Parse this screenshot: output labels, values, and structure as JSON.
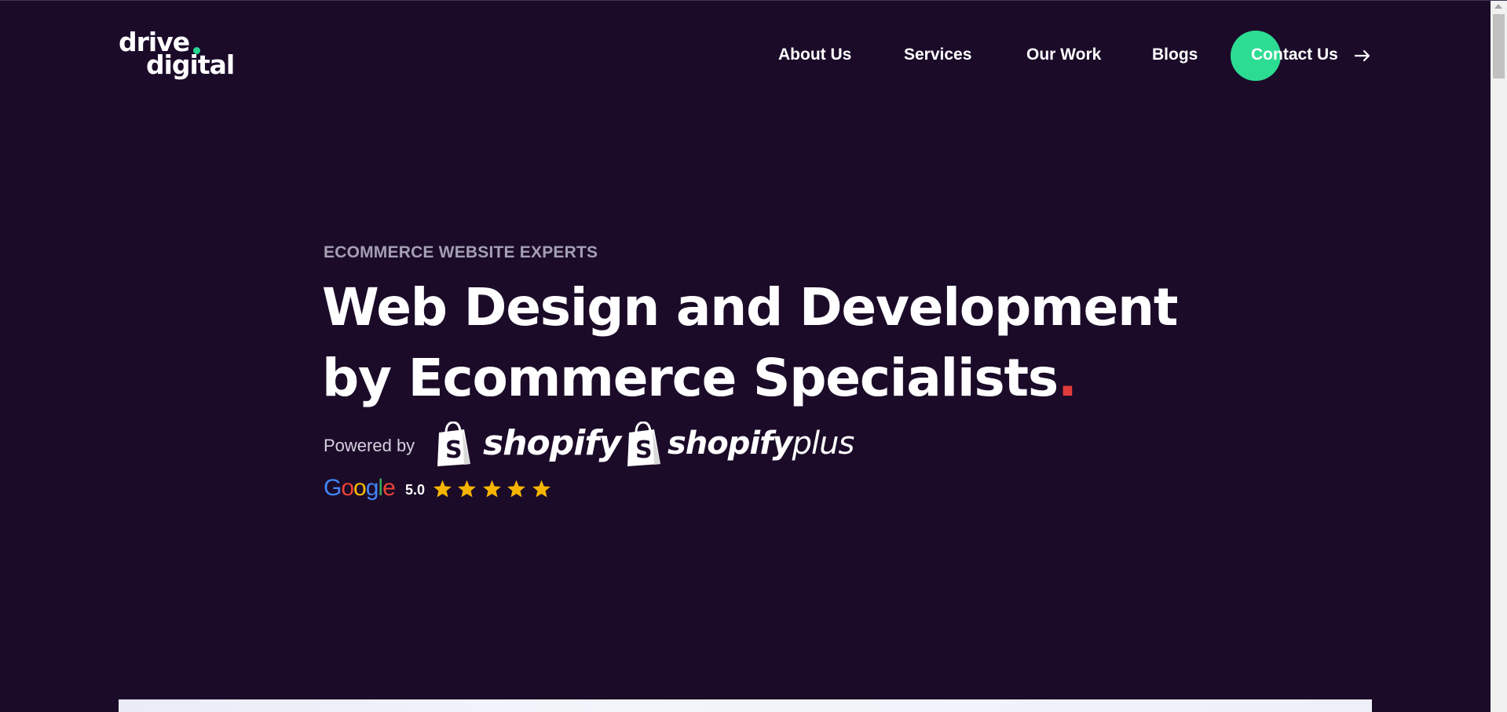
{
  "header": {
    "logo": {
      "line1": "drive",
      "line2": "digital",
      "dot_color": "#27d592"
    },
    "nav": [
      {
        "label": "About Us"
      },
      {
        "label": "Services"
      },
      {
        "label": "Our Work"
      },
      {
        "label": "Blogs"
      }
    ],
    "contact": {
      "label": "Contact Us",
      "icon": "arrow-right-icon",
      "bubble_color": "#2ddc93"
    }
  },
  "hero": {
    "eyebrow": "ECOMMERCE WEBSITE EXPERTS",
    "headline_line1": "Web Design and Development",
    "headline_line2": "by Ecommerce Specialists",
    "headline_dot": ".",
    "accent_color": "#e23b3b",
    "powered_by": "Powered by",
    "brands": [
      {
        "name": "shopify",
        "icon": "shopify-bag-icon"
      },
      {
        "name": "shopify",
        "suffix": "plus",
        "icon": "shopify-bag-icon"
      }
    ],
    "review": {
      "provider": "Google",
      "score": "5.0",
      "stars": 5,
      "star_color": "#f6b400"
    }
  },
  "colors": {
    "background": "#1b0b29",
    "text": "#ffffff",
    "muted": "#a59fb3"
  }
}
